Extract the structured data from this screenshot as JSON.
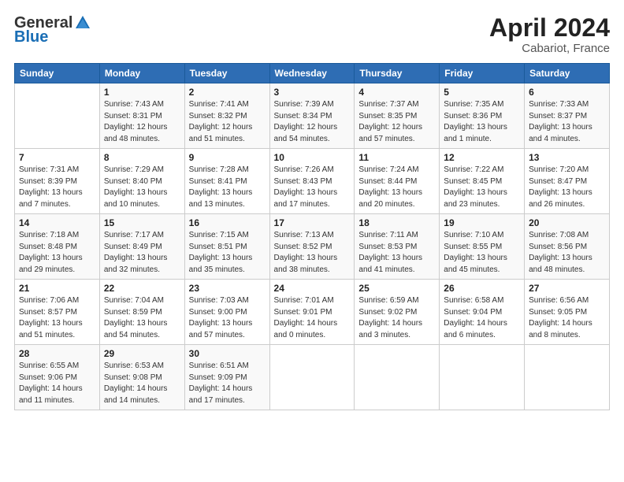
{
  "header": {
    "logo_general": "General",
    "logo_blue": "Blue",
    "month_year": "April 2024",
    "location": "Cabariot, France"
  },
  "days_of_week": [
    "Sunday",
    "Monday",
    "Tuesday",
    "Wednesday",
    "Thursday",
    "Friday",
    "Saturday"
  ],
  "weeks": [
    [
      {
        "day": "",
        "info": ""
      },
      {
        "day": "1",
        "info": "Sunrise: 7:43 AM\nSunset: 8:31 PM\nDaylight: 12 hours\nand 48 minutes."
      },
      {
        "day": "2",
        "info": "Sunrise: 7:41 AM\nSunset: 8:32 PM\nDaylight: 12 hours\nand 51 minutes."
      },
      {
        "day": "3",
        "info": "Sunrise: 7:39 AM\nSunset: 8:34 PM\nDaylight: 12 hours\nand 54 minutes."
      },
      {
        "day": "4",
        "info": "Sunrise: 7:37 AM\nSunset: 8:35 PM\nDaylight: 12 hours\nand 57 minutes."
      },
      {
        "day": "5",
        "info": "Sunrise: 7:35 AM\nSunset: 8:36 PM\nDaylight: 13 hours\nand 1 minute."
      },
      {
        "day": "6",
        "info": "Sunrise: 7:33 AM\nSunset: 8:37 PM\nDaylight: 13 hours\nand 4 minutes."
      }
    ],
    [
      {
        "day": "7",
        "info": "Sunrise: 7:31 AM\nSunset: 8:39 PM\nDaylight: 13 hours\nand 7 minutes."
      },
      {
        "day": "8",
        "info": "Sunrise: 7:29 AM\nSunset: 8:40 PM\nDaylight: 13 hours\nand 10 minutes."
      },
      {
        "day": "9",
        "info": "Sunrise: 7:28 AM\nSunset: 8:41 PM\nDaylight: 13 hours\nand 13 minutes."
      },
      {
        "day": "10",
        "info": "Sunrise: 7:26 AM\nSunset: 8:43 PM\nDaylight: 13 hours\nand 17 minutes."
      },
      {
        "day": "11",
        "info": "Sunrise: 7:24 AM\nSunset: 8:44 PM\nDaylight: 13 hours\nand 20 minutes."
      },
      {
        "day": "12",
        "info": "Sunrise: 7:22 AM\nSunset: 8:45 PM\nDaylight: 13 hours\nand 23 minutes."
      },
      {
        "day": "13",
        "info": "Sunrise: 7:20 AM\nSunset: 8:47 PM\nDaylight: 13 hours\nand 26 minutes."
      }
    ],
    [
      {
        "day": "14",
        "info": "Sunrise: 7:18 AM\nSunset: 8:48 PM\nDaylight: 13 hours\nand 29 minutes."
      },
      {
        "day": "15",
        "info": "Sunrise: 7:17 AM\nSunset: 8:49 PM\nDaylight: 13 hours\nand 32 minutes."
      },
      {
        "day": "16",
        "info": "Sunrise: 7:15 AM\nSunset: 8:51 PM\nDaylight: 13 hours\nand 35 minutes."
      },
      {
        "day": "17",
        "info": "Sunrise: 7:13 AM\nSunset: 8:52 PM\nDaylight: 13 hours\nand 38 minutes."
      },
      {
        "day": "18",
        "info": "Sunrise: 7:11 AM\nSunset: 8:53 PM\nDaylight: 13 hours\nand 41 minutes."
      },
      {
        "day": "19",
        "info": "Sunrise: 7:10 AM\nSunset: 8:55 PM\nDaylight: 13 hours\nand 45 minutes."
      },
      {
        "day": "20",
        "info": "Sunrise: 7:08 AM\nSunset: 8:56 PM\nDaylight: 13 hours\nand 48 minutes."
      }
    ],
    [
      {
        "day": "21",
        "info": "Sunrise: 7:06 AM\nSunset: 8:57 PM\nDaylight: 13 hours\nand 51 minutes."
      },
      {
        "day": "22",
        "info": "Sunrise: 7:04 AM\nSunset: 8:59 PM\nDaylight: 13 hours\nand 54 minutes."
      },
      {
        "day": "23",
        "info": "Sunrise: 7:03 AM\nSunset: 9:00 PM\nDaylight: 13 hours\nand 57 minutes."
      },
      {
        "day": "24",
        "info": "Sunrise: 7:01 AM\nSunset: 9:01 PM\nDaylight: 14 hours\nand 0 minutes."
      },
      {
        "day": "25",
        "info": "Sunrise: 6:59 AM\nSunset: 9:02 PM\nDaylight: 14 hours\nand 3 minutes."
      },
      {
        "day": "26",
        "info": "Sunrise: 6:58 AM\nSunset: 9:04 PM\nDaylight: 14 hours\nand 6 minutes."
      },
      {
        "day": "27",
        "info": "Sunrise: 6:56 AM\nSunset: 9:05 PM\nDaylight: 14 hours\nand 8 minutes."
      }
    ],
    [
      {
        "day": "28",
        "info": "Sunrise: 6:55 AM\nSunset: 9:06 PM\nDaylight: 14 hours\nand 11 minutes."
      },
      {
        "day": "29",
        "info": "Sunrise: 6:53 AM\nSunset: 9:08 PM\nDaylight: 14 hours\nand 14 minutes."
      },
      {
        "day": "30",
        "info": "Sunrise: 6:51 AM\nSunset: 9:09 PM\nDaylight: 14 hours\nand 17 minutes."
      },
      {
        "day": "",
        "info": ""
      },
      {
        "day": "",
        "info": ""
      },
      {
        "day": "",
        "info": ""
      },
      {
        "day": "",
        "info": ""
      }
    ]
  ]
}
